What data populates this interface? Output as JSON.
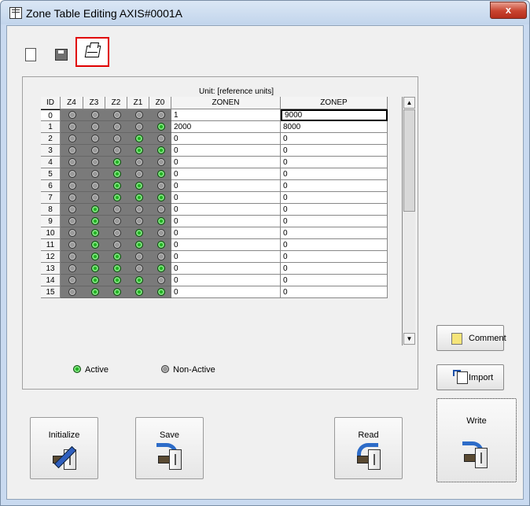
{
  "window": {
    "title": "Zone Table Editing AXIS#0001A",
    "close_label": "x"
  },
  "toolbar": {
    "icons": [
      "document-icon",
      "save-icon",
      "print-icon"
    ]
  },
  "table": {
    "unit_label": "Unit:  [reference units]",
    "headers": {
      "id": "ID",
      "z4": "Z4",
      "z3": "Z3",
      "z2": "Z2",
      "z1": "Z1",
      "z0": "Z0",
      "zonen": "ZONEN",
      "zonep": "ZONEP"
    },
    "rows": [
      {
        "id": "0",
        "leds": [
          0,
          0,
          0,
          0,
          0
        ],
        "zonen": "1",
        "zonep": "9000"
      },
      {
        "id": "1",
        "leds": [
          0,
          0,
          0,
          0,
          1
        ],
        "zonen": "2000",
        "zonep": "8000"
      },
      {
        "id": "2",
        "leds": [
          0,
          0,
          0,
          1,
          0
        ],
        "zonen": "0",
        "zonep": "0"
      },
      {
        "id": "3",
        "leds": [
          0,
          0,
          0,
          1,
          1
        ],
        "zonen": "0",
        "zonep": "0"
      },
      {
        "id": "4",
        "leds": [
          0,
          0,
          1,
          0,
          0
        ],
        "zonen": "0",
        "zonep": "0"
      },
      {
        "id": "5",
        "leds": [
          0,
          0,
          1,
          0,
          1
        ],
        "zonen": "0",
        "zonep": "0"
      },
      {
        "id": "6",
        "leds": [
          0,
          0,
          1,
          1,
          0
        ],
        "zonen": "0",
        "zonep": "0"
      },
      {
        "id": "7",
        "leds": [
          0,
          0,
          1,
          1,
          1
        ],
        "zonen": "0",
        "zonep": "0"
      },
      {
        "id": "8",
        "leds": [
          0,
          1,
          0,
          0,
          0
        ],
        "zonen": "0",
        "zonep": "0"
      },
      {
        "id": "9",
        "leds": [
          0,
          1,
          0,
          0,
          1
        ],
        "zonen": "0",
        "zonep": "0"
      },
      {
        "id": "10",
        "leds": [
          0,
          1,
          0,
          1,
          0
        ],
        "zonen": "0",
        "zonep": "0"
      },
      {
        "id": "11",
        "leds": [
          0,
          1,
          0,
          1,
          1
        ],
        "zonen": "0",
        "zonep": "0"
      },
      {
        "id": "12",
        "leds": [
          0,
          1,
          1,
          0,
          0
        ],
        "zonen": "0",
        "zonep": "0"
      },
      {
        "id": "13",
        "leds": [
          0,
          1,
          1,
          0,
          1
        ],
        "zonen": "0",
        "zonep": "0"
      },
      {
        "id": "14",
        "leds": [
          0,
          1,
          1,
          1,
          0
        ],
        "zonen": "0",
        "zonep": "0"
      },
      {
        "id": "15",
        "leds": [
          0,
          1,
          1,
          1,
          1
        ],
        "zonen": "0",
        "zonep": "0"
      }
    ],
    "legend": {
      "active": "Active",
      "non_active": "Non-Active"
    },
    "colors": {
      "active": "#1fb21f",
      "non_active": "#9a9a9a",
      "led_background": "#7a7a7a"
    }
  },
  "side_buttons": {
    "comment": "Comment",
    "import": "Import"
  },
  "bottom_buttons": {
    "initialize": "Initialize",
    "save": "Save",
    "read": "Read",
    "write": "Write"
  }
}
